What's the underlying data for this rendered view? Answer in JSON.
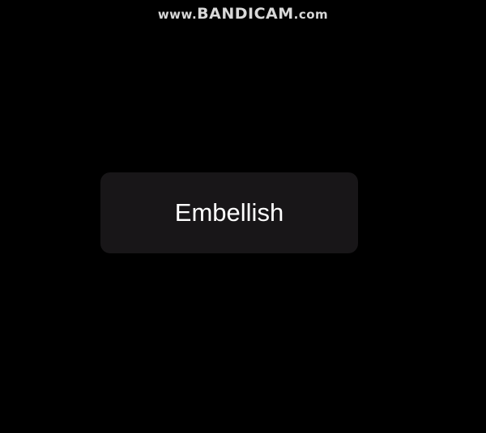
{
  "watermark": {
    "prefix": "www.",
    "brand": "BANDICAM",
    "suffix": ".com"
  },
  "button": {
    "label": "Embellish"
  },
  "colors": {
    "background": "#000000",
    "button_bg": "#181618",
    "button_text": "#ffffff",
    "watermark_text": "#d8d8d8"
  }
}
